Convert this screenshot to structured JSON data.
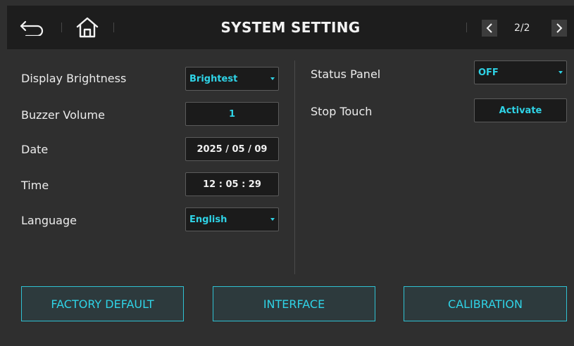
{
  "header": {
    "title": "SYSTEM SETTING",
    "page_indicator": "2/2"
  },
  "left_settings": {
    "brightness": {
      "label": "Display Brightness",
      "value": "Brightest"
    },
    "buzzer": {
      "label": "Buzzer Volume",
      "value": "1"
    },
    "date": {
      "label": "Date",
      "value": "2025 / 05 / 09"
    },
    "time": {
      "label": "Time",
      "value": "12 : 05 : 29"
    },
    "language": {
      "label": "Language",
      "value": "English"
    }
  },
  "right_settings": {
    "status_panel": {
      "label": "Status Panel",
      "value": "OFF"
    },
    "stop_touch": {
      "label": "Stop Touch",
      "value": "Activate"
    }
  },
  "bottom_buttons": {
    "factory_default": "FACTORY DEFAULT",
    "interface": "INTERFACE",
    "calibration": "CALIBRATION"
  },
  "colors": {
    "accent": "#2fd3e6",
    "background": "#2f2f2f",
    "header_bg": "#1d1d1d",
    "button_bg": "#2d3a3d"
  },
  "icons": [
    "back-arrow-icon",
    "home-icon",
    "chevron-left-icon",
    "chevron-right-icon",
    "dropdown-caret-icon"
  ]
}
